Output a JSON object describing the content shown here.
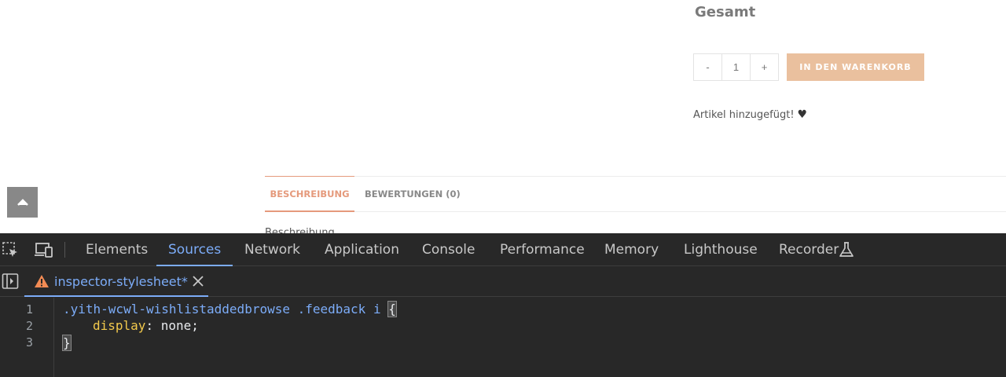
{
  "site": {
    "total_label": "Gesamt",
    "qty_minus": "-",
    "qty_value": "1",
    "qty_plus": "+",
    "add_to_cart": "IN DEN WARENKORB",
    "added_message": "Artikel hinzugefügt!",
    "heart_glyph": "♥",
    "tabs": [
      {
        "label": "BESCHREIBUNG",
        "active": true
      },
      {
        "label": "BEWERTUNGEN (0)",
        "active": false
      }
    ],
    "cut_text": "Beschreibung"
  },
  "devtools": {
    "panel_tabs": [
      {
        "label": "Elements"
      },
      {
        "label": "Sources",
        "active": true
      },
      {
        "label": "Network"
      },
      {
        "label": "Application"
      },
      {
        "label": "Console"
      },
      {
        "label": "Performance"
      },
      {
        "label": "Memory"
      },
      {
        "label": "Lighthouse"
      },
      {
        "label": "Recorder"
      }
    ],
    "file_tab": "inspector-stylesheet*",
    "code": {
      "line_numbers": [
        "1",
        "2",
        "3"
      ],
      "selector": ".yith-wcwl-wishlistaddedbrowse .feedback i",
      "open_brace": "{",
      "property": "display",
      "colon": ":",
      "value": "none",
      "semicolon": ";",
      "close_brace": "}"
    },
    "accent_color": "#7cacf8",
    "warning_color": "#f28b54"
  }
}
